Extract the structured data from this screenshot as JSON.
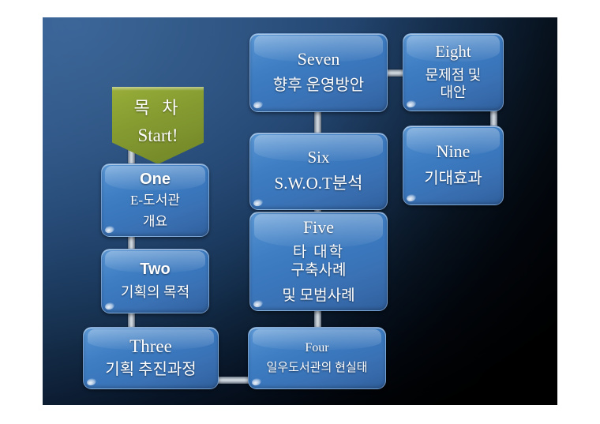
{
  "slide": {
    "title": "Table of Contents flow diagram",
    "background_top_color": "#3d6699",
    "background_bottom_color": "#000000"
  },
  "start": {
    "name": "start-marker",
    "line_ko": "목 차",
    "line_en": "Start!",
    "color": "#8a9f34"
  },
  "connectors": {
    "color": "#cdd5dd"
  },
  "nodes": [
    {
      "id": "one",
      "number": "One",
      "number_style": "sans-bold",
      "lines": [
        "E-도서관",
        "개요"
      ],
      "color": "#3a77bd"
    },
    {
      "id": "two",
      "number": "Two",
      "number_style": "sans-bold",
      "lines": [
        "기획의 목적"
      ],
      "color": "#3a77bd"
    },
    {
      "id": "three",
      "number": "Three",
      "number_style": "serif",
      "lines": [
        "기획 추진과정"
      ],
      "color": "#3a77bd"
    },
    {
      "id": "four",
      "number": "Four",
      "number_style": "serif",
      "lines": [
        "일우도서관의 현실태"
      ],
      "color": "#3a77bd"
    },
    {
      "id": "five",
      "number": "Five",
      "number_style": "serif",
      "lines": [
        "타 대학",
        "구축사례",
        "및 모범사례"
      ],
      "color": "#3a77bd"
    },
    {
      "id": "six",
      "number": "Six",
      "number_style": "serif",
      "lines": [
        "S.W.O.T분석"
      ],
      "color": "#3a77bd"
    },
    {
      "id": "seven",
      "number": "Seven",
      "number_style": "serif",
      "lines": [
        "향후 운영방안"
      ],
      "color": "#3a77bd"
    },
    {
      "id": "eight",
      "number": "Eight",
      "number_style": "serif",
      "lines": [
        "문제점 및",
        "대안"
      ],
      "color": "#3a77bd"
    },
    {
      "id": "nine",
      "number": "Nine",
      "number_style": "serif",
      "lines": [
        "기대효과"
      ],
      "color": "#3a77bd"
    }
  ]
}
